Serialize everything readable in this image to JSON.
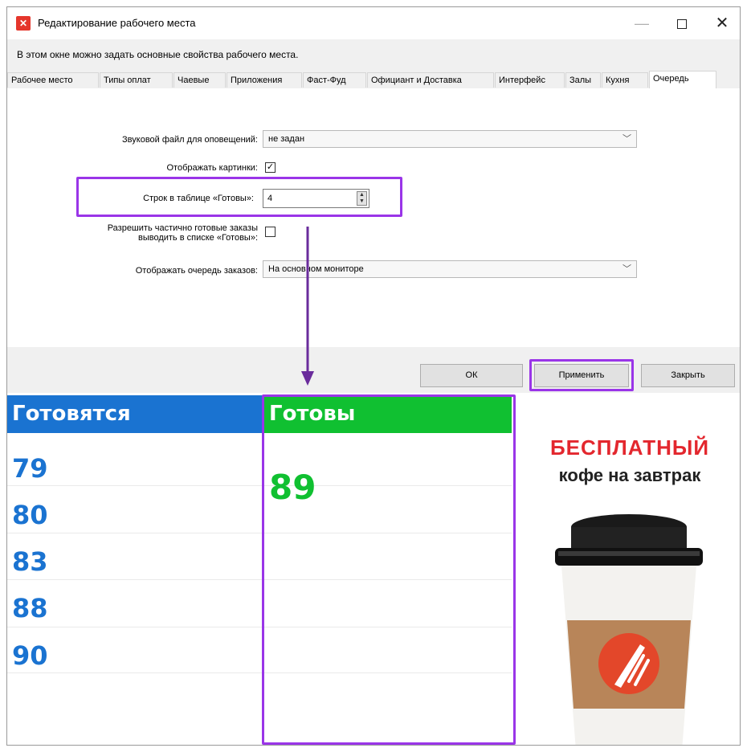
{
  "window": {
    "title": "Редактирование рабочего места",
    "description": "В этом окне можно задать основные свойства рабочего места.",
    "min": "—",
    "close": "✕"
  },
  "tabs": [
    "Рабочее место",
    "Типы оплат",
    "Чаевые",
    "Приложения",
    "Фаст-Фуд",
    "Официант и Доставка",
    "Интерфейс",
    "Залы",
    "Кухня",
    "Очередь"
  ],
  "active_tab": "Очередь",
  "form": {
    "sound_label": "Звуковой файл для оповещений:",
    "sound_value": "не задан",
    "show_images_label": "Отображать картинки:",
    "show_images_checked": true,
    "rows_label": "Строк в таблице «Готовы»:",
    "rows_value": "4",
    "partial_label_1": "Разрешить частично готовые заказы",
    "partial_label_2": "выводить в списке «Готовы»:",
    "partial_checked": false,
    "queue_display_label": "Отображать очередь заказов:",
    "queue_display_value": "На основном мониторе"
  },
  "buttons": {
    "ok": "ОК",
    "apply": "Применить",
    "close": "Закрыть"
  },
  "queue": {
    "preparing_title": "Готовятся",
    "ready_title": "Готовы",
    "preparing": [
      "79",
      "80",
      "83",
      "88",
      "90"
    ],
    "ready": [
      "89"
    ]
  },
  "promo": {
    "line1": "БЕСПЛАТНЫЙ",
    "line2": "кофе на завтрак"
  },
  "colors": {
    "highlight": "#9a35e8",
    "preparing": "#1a73d1",
    "ready": "#10c031",
    "promo": "#e3272e"
  }
}
